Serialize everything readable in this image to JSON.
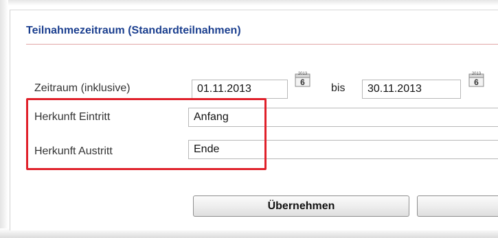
{
  "section": {
    "title": "Teilnahmezeitraum (Standardteilnahmen)"
  },
  "period": {
    "label": "Zeitraum (inklusive)",
    "from_value": "01.11.2013",
    "separator": "bis",
    "to_value": "30.11.2013",
    "calendar_icon_year": "2013",
    "calendar_icon_day": "6"
  },
  "entry_origin": {
    "label": "Herkunft Eintritt",
    "value": "Anfang"
  },
  "exit_origin": {
    "label": "Herkunft Austritt",
    "value": "Ende"
  },
  "buttons": {
    "apply_label": "Übernehmen",
    "second_label": ""
  },
  "colors": {
    "title": "#1b3f8f",
    "highlight": "#e0202a",
    "rule": "#e1a6a6"
  }
}
